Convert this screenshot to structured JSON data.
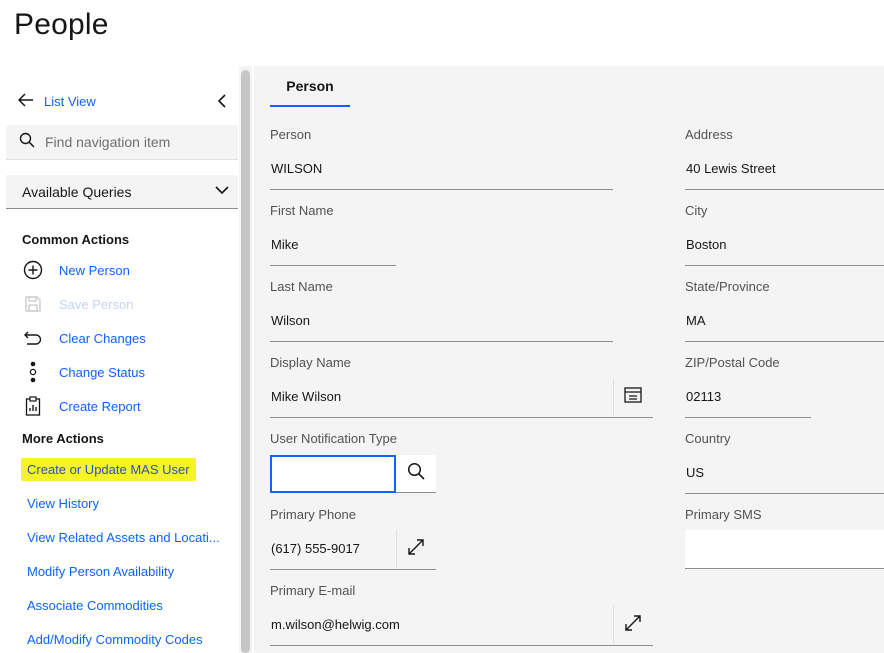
{
  "page": {
    "title": "People"
  },
  "nav": {
    "back_label": "List View",
    "search_placeholder": "Find navigation item",
    "queries_label": "Available Queries",
    "common_title": "Common Actions",
    "common_actions": [
      {
        "label": "New Person",
        "icon": "add-circle-icon",
        "enabled": true
      },
      {
        "label": "Save Person",
        "icon": "save-icon",
        "enabled": false
      },
      {
        "label": "Clear Changes",
        "icon": "undo-icon",
        "enabled": true
      },
      {
        "label": "Change Status",
        "icon": "status-dots-icon",
        "enabled": true
      },
      {
        "label": "Create Report",
        "icon": "report-clipboard-icon",
        "enabled": true
      }
    ],
    "more_title": "More Actions",
    "more_actions": [
      "Create or Update MAS User",
      "View History",
      "View Related Assets and Locati...",
      "Modify Person Availability",
      "Associate Commodities",
      "Add/Modify Commodity Codes"
    ],
    "highlight_color": "#f6f32a"
  },
  "tabs": [
    {
      "label": "Person",
      "active": true
    }
  ],
  "form": {
    "left": {
      "person": {
        "label": "Person",
        "value": "WILSON"
      },
      "first_name": {
        "label": "First Name",
        "value": "Mike"
      },
      "last_name": {
        "label": "Last Name",
        "value": "Wilson"
      },
      "display_name": {
        "label": "Display Name",
        "value": "Mike Wilson"
      },
      "notification_type": {
        "label": "User Notification Type",
        "value": ""
      },
      "primary_phone": {
        "label": "Primary Phone",
        "value": "(617) 555-9017"
      },
      "primary_email": {
        "label": "Primary E-mail",
        "value": "m.wilson@helwig.com"
      }
    },
    "right": {
      "address": {
        "label": "Address",
        "value": "40 Lewis Street"
      },
      "city": {
        "label": "City",
        "value": "Boston"
      },
      "state": {
        "label": "State/Province",
        "value": "MA"
      },
      "zip": {
        "label": "ZIP/Postal Code",
        "value": "02113"
      },
      "country": {
        "label": "Country",
        "value": "US"
      },
      "primary_sms": {
        "label": "Primary SMS",
        "value": ""
      }
    }
  },
  "colors": {
    "accent": "#0f62fe",
    "main_bg": "#f4f4f4"
  }
}
